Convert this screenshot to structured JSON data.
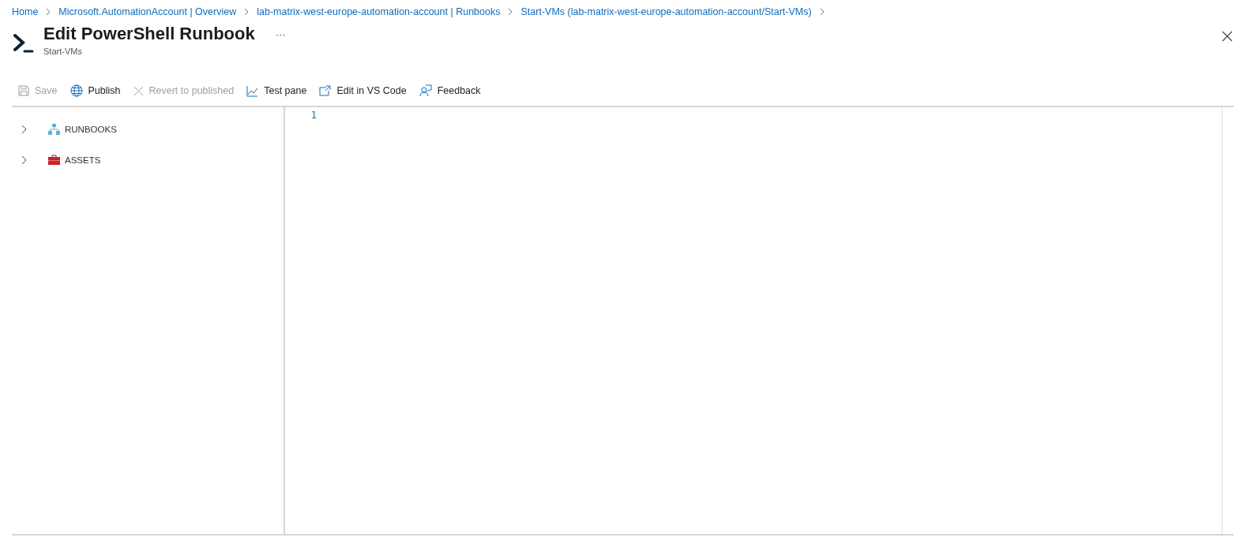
{
  "breadcrumbs": [
    "Home",
    "Microsoft.AutomationAccount | Overview",
    "lab-matrix-west-europe-automation-account | Runbooks",
    "Start-VMs (lab-matrix-west-europe-automation-account/Start-VMs)"
  ],
  "header": {
    "title": "Edit PowerShell Runbook",
    "more": "···",
    "subtitle": "Start-VMs"
  },
  "toolbar": [
    {
      "kind": "save",
      "label": "Save",
      "disabled": true
    },
    {
      "kind": "publish",
      "label": "Publish",
      "disabled": false
    },
    {
      "kind": "revert",
      "label": "Revert to published",
      "disabled": true
    },
    {
      "kind": "test",
      "label": "Test pane",
      "disabled": false
    },
    {
      "kind": "vscode",
      "label": "Edit in VS Code",
      "disabled": false
    },
    {
      "kind": "feedback",
      "label": "Feedback",
      "disabled": false
    }
  ],
  "tree": [
    {
      "kind": "runbooks",
      "label": "RUNBOOKS",
      "expanded": false
    },
    {
      "kind": "assets",
      "label": "ASSETS",
      "expanded": false
    }
  ],
  "editor": {
    "line_numbers": [
      "1"
    ]
  }
}
